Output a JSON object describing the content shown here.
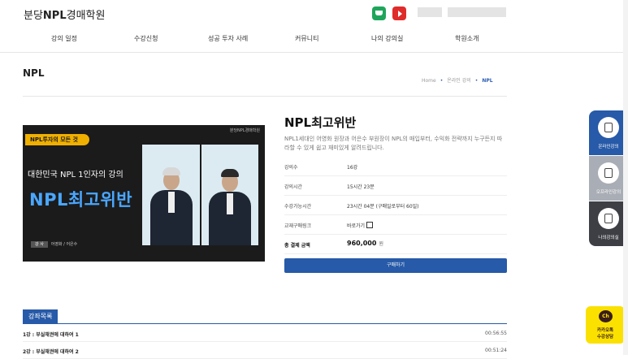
{
  "header": {
    "logo_prefix": "분당",
    "logo_bold": "NPL",
    "logo_suffix": "경매학원",
    "nav": [
      "강의 일정",
      "수강신청",
      "성공 투자 사례",
      "커뮤니티",
      "나의 강의실",
      "학원소개"
    ]
  },
  "page": {
    "title": "NPL",
    "breadcrumb": [
      "Home",
      "온라인 강의",
      "NPL"
    ]
  },
  "banner": {
    "tag": "NPL투자의 모든 것",
    "brand": "분당NPL경매학원",
    "subtitle": "대한민국 NPL 1인자의 강의",
    "headline": "NPL최고위반",
    "instructor_label": "강 사",
    "instructors": "어영화 / 어은수"
  },
  "course": {
    "title": "NPL최고위반",
    "description": "NPL1세대인 어영화 원장과 어은수 부원장이 NPL의 매입부터, 수익화 전략까지 누구든지 따라할 수 있게 쉽고 재미있게 알려드립니다.",
    "rows": [
      {
        "label": "강의수",
        "value": "16강"
      },
      {
        "label": "강의시간",
        "value": "15시간 23분"
      },
      {
        "label": "수강가능시간",
        "value": "23시간 04분 (구매일로부터 60일)"
      },
      {
        "label": "교재구매링크",
        "value": "바로가기"
      }
    ],
    "total_label": "총 결제 금액",
    "total_value": "960,000",
    "total_unit": "원",
    "buy_label": "구매하기"
  },
  "lecture_list": {
    "tab_label": "강좌목록",
    "items": [
      {
        "title": "1강 : 부실채권에 대하여 1",
        "duration": "00:56:55"
      },
      {
        "title": "2강 : 부실채권에 대하여 2",
        "duration": "00:51:24"
      }
    ]
  },
  "quick_menu": {
    "items": [
      {
        "label": "온라인강의",
        "icon": "monitor-icon"
      },
      {
        "label": "오프라인강의",
        "icon": "document-icon"
      },
      {
        "label": "나의강의실",
        "icon": "clipboard-icon"
      }
    ]
  },
  "kakao": {
    "badge": "Ch",
    "line1": "카카오톡",
    "line2": "수강상담"
  },
  "colors": {
    "accent": "#275aa8",
    "banner_headline": "#4aa7ff",
    "tag": "#f0b000",
    "kakao": "#fae100"
  }
}
